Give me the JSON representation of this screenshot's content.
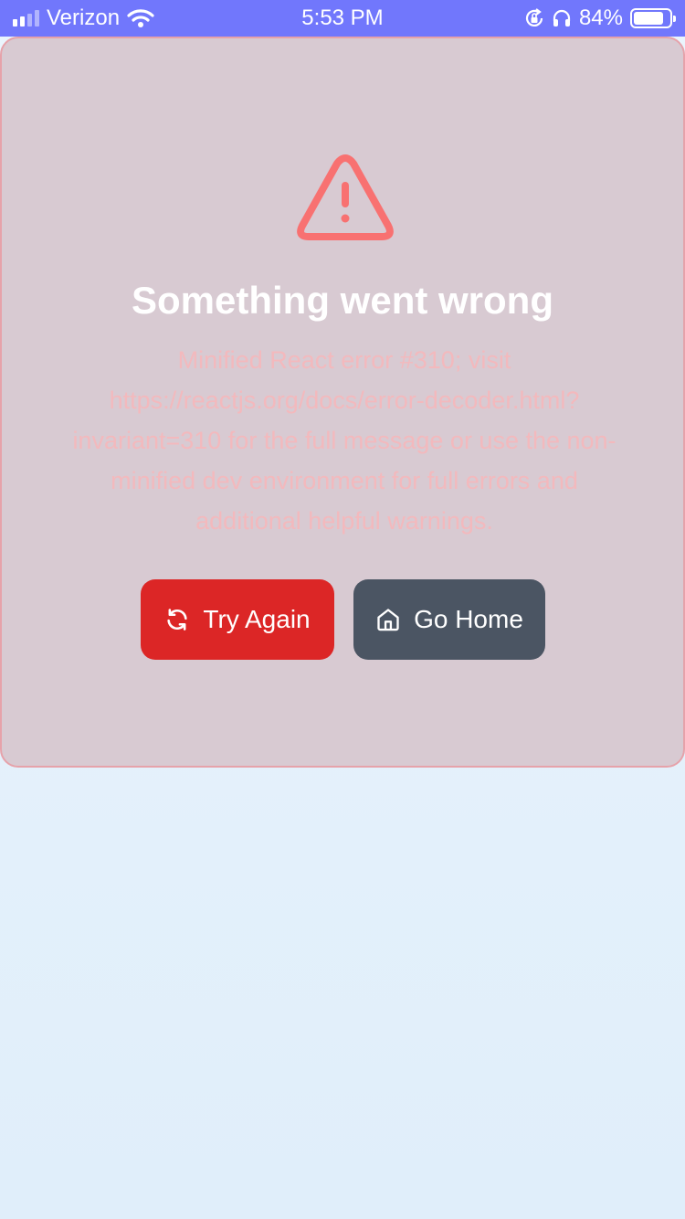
{
  "status_bar": {
    "carrier": "Verizon",
    "time": "5:53 PM",
    "battery_percent": "84%",
    "battery_level": 0.84
  },
  "error": {
    "title": "Something went wrong",
    "message": "Minified React error #310; visit https://reactjs.org/docs/error-decoder.html?invariant=310 for the full message or use the non-minified dev environment for full errors and additional helpful warnings."
  },
  "actions": {
    "retry_label": "Try Again",
    "home_label": "Go Home"
  },
  "colors": {
    "status_bar": "#7177fc",
    "card_background": "#d8cad2",
    "card_border": "#e6a2aa",
    "warning_icon": "#f87171",
    "retry_button": "#dc2626",
    "home_button": "#4b5563"
  },
  "icons": {
    "warning": "alert-triangle-icon",
    "retry": "refresh-icon",
    "home": "home-icon"
  }
}
